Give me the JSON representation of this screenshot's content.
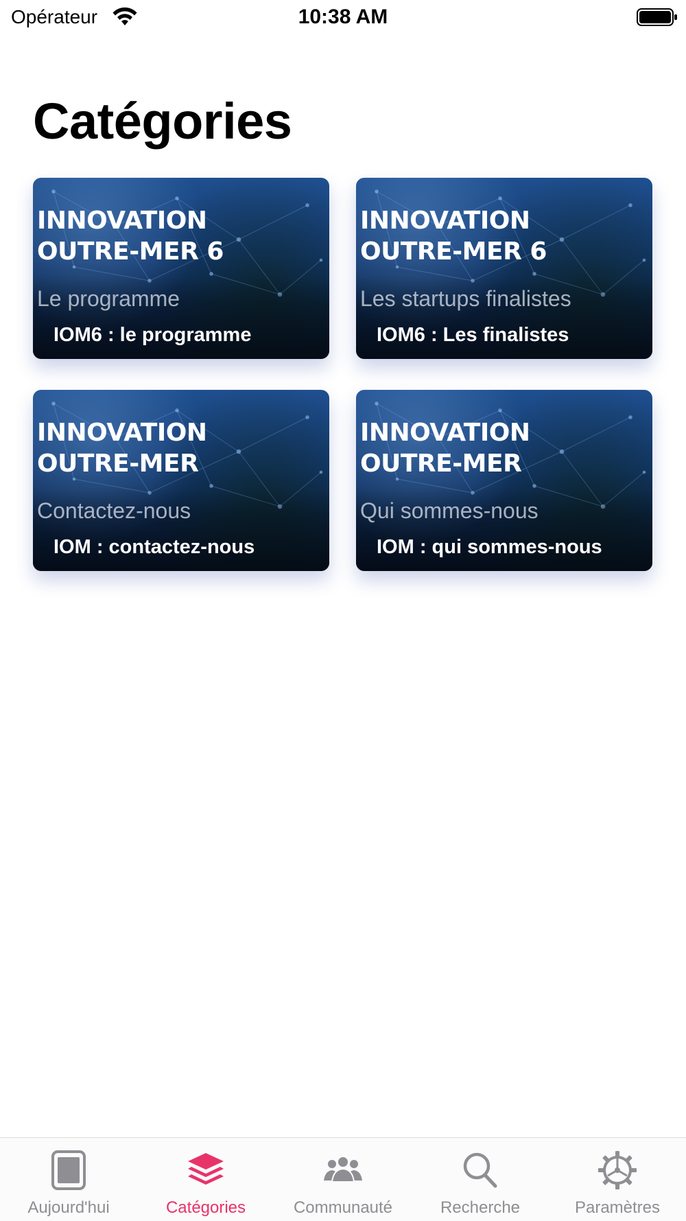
{
  "status_bar": {
    "carrier": "Opérateur",
    "time": "10:38 AM"
  },
  "page": {
    "title": "Catégories"
  },
  "cards": [
    {
      "heading_line1": "INNOVATION",
      "heading_line2": "OUTRE-MER 6",
      "subtitle": "Le programme",
      "caption": "IOM6 : le programme"
    },
    {
      "heading_line1": "INNOVATION",
      "heading_line2": "OUTRE-MER 6",
      "subtitle": "Les startups finalistes",
      "caption": "IOM6 : Les finalistes"
    },
    {
      "heading_line1": "INNOVATION",
      "heading_line2": "OUTRE-MER",
      "subtitle": "Contactez-nous",
      "caption": "IOM : contactez-nous"
    },
    {
      "heading_line1": "INNOVATION",
      "heading_line2": "OUTRE-MER",
      "subtitle": "Qui sommes-nous",
      "caption": "IOM : qui sommes-nous"
    }
  ],
  "tab_bar": {
    "tabs": [
      {
        "label": "Aujourd'hui",
        "icon": "today-icon",
        "active": false
      },
      {
        "label": "Catégories",
        "icon": "layers-icon",
        "active": true
      },
      {
        "label": "Communauté",
        "icon": "community-icon",
        "active": false
      },
      {
        "label": "Recherche",
        "icon": "search-icon",
        "active": false
      },
      {
        "label": "Paramètres",
        "icon": "gear-icon",
        "active": false
      }
    ]
  },
  "colors": {
    "accent": "#e8336a",
    "inactive_tab": "#8e8e93",
    "card_blue": "#133a70"
  }
}
